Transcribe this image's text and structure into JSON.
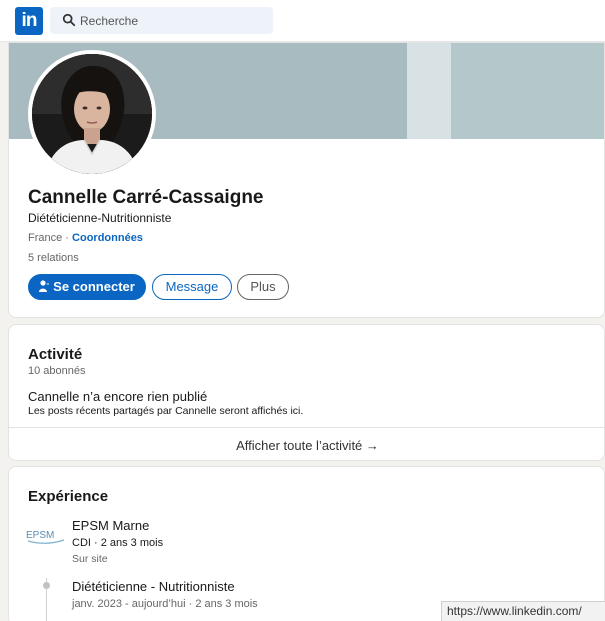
{
  "nav": {
    "logo_text": "in",
    "search_placeholder": "Recherche"
  },
  "profile": {
    "name": "Cannelle Carré-Cassaigne",
    "headline": "Diététicienne-Nutritionniste",
    "location": "France",
    "separator": " · ",
    "contact_link": "Coordonnées",
    "relations": "5 relations",
    "connect_label": "Se connecter",
    "message_label": "Message",
    "more_label": "Plus"
  },
  "activity": {
    "title": "Activité",
    "followers": "10 abonnés",
    "empty_title": "Cannelle n’a encore rien publié",
    "empty_desc": "Les posts récents partagés par Cannelle seront affichés ici.",
    "show_all": "Afficher toute l’activité →"
  },
  "experience": {
    "title": "Expérience",
    "company_logo_text": "EPSM",
    "company": "EPSM Marne",
    "contract": "CDI · 2 ans 3 mois",
    "site": "Sur site",
    "role_title": "Diététicienne - Nutritionniste",
    "role_dates": "janv. 2023 - aujourd’hui · 2 ans 3 mois"
  },
  "status_bar": {
    "url": "https://www.linkedin.com/"
  },
  "colors": {
    "brand_blue": "#0a66c2",
    "banner": "#a9bcc2",
    "page_bg": "#f4f2ee"
  },
  "icons": {
    "search": "search-icon",
    "connect": "add-person-icon",
    "arrow": "arrow-right-icon"
  }
}
